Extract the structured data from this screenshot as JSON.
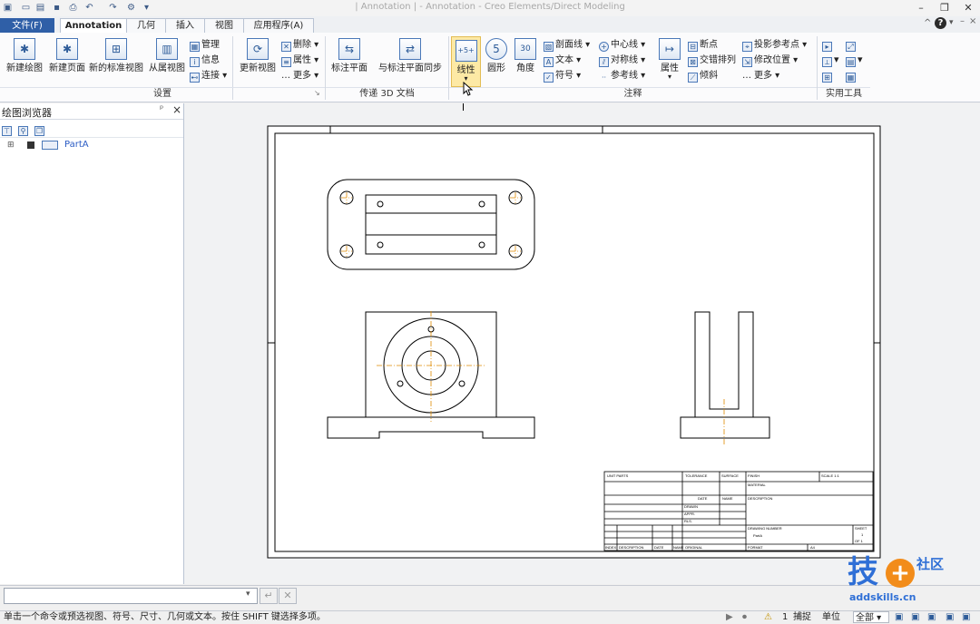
{
  "window": {
    "title": "| Annotation | - Annotation - Creo Elements/Direct Modeling",
    "help_label": "?"
  },
  "tabs": [
    {
      "label": "文件(F)"
    },
    {
      "label": "Annotation"
    },
    {
      "label": "几何"
    },
    {
      "label": "插入"
    },
    {
      "label": "视图"
    },
    {
      "label": "应用程序(A)"
    }
  ],
  "ribbon": {
    "settings": {
      "new_drawing": "新建绘图",
      "new_page": "新建页面",
      "new_std_view": "新的标准视图",
      "from_view": "从属视图",
      "manage": "管理",
      "info": "信息",
      "connect": "连接",
      "update_view": "更新视图",
      "delete": "删除",
      "properties": "属性",
      "more": "更多",
      "group": "设置"
    },
    "transfer": {
      "mark_plane": "标注平面",
      "sync_plane": "与标注平面同步",
      "group": "传递 3D 文档"
    },
    "annotation": {
      "linear": "线性",
      "circular": "圆形",
      "angle": "角度",
      "section_line": "剖面线",
      "text": "文本",
      "symbol": "符号",
      "center_line": "中心线",
      "symmetry_line": "对称线",
      "ref_line": "参考线",
      "attribute": "属性",
      "break": "断点",
      "stagger": "交错排列",
      "tilt": "倾斜",
      "proj_ref_point": "投影参考点",
      "modify_pos": "修改位置",
      "more": "更多",
      "group": "注释",
      "linear_sub": "+5+",
      "circular_sub": "5",
      "angle_sub": "30"
    },
    "tools": {
      "group": "实用工具"
    }
  },
  "browser": {
    "title": "绘图浏览器",
    "tree_item": "PartA",
    "pin": "ᵖ",
    "close": "×"
  },
  "title_block": {
    "cells": [
      "UNIT PARTS",
      "TOLERANCE",
      "SURFACE",
      "FINISH",
      "SCALE 1:1",
      "MATERIAL",
      "DESCRIPTION",
      "DATE",
      "NAME",
      "DRAWN",
      "APPR.",
      "RLS.",
      "DRAWING NUMBER",
      "PartA",
      "SHEET",
      "1",
      "OF 1",
      "INDEX",
      "DESCRIPTION",
      "DATE",
      "NAME",
      "ORIGINAL",
      "FORMAT",
      "A4"
    ]
  },
  "command_line": {
    "placeholder": ""
  },
  "status": {
    "message": "单击一个命令或预选视图、符号、尺寸、几何或文本。按住 SHIFT 键选择多项。",
    "count": "1",
    "snap": "捕捉",
    "units_label": "单位",
    "filter": "全部"
  },
  "watermark": {
    "brand_text": "技",
    "brand_text2": "社区",
    "url": "addskills.cn"
  },
  "colors": {
    "ribbon_accent": "#4a78b8",
    "active_button": "#fde9a5",
    "center_line": "#e08a00",
    "drawing_line": "#000000",
    "watermark_blue": "#2f6fd6",
    "watermark_orange": "#f28c1a"
  }
}
